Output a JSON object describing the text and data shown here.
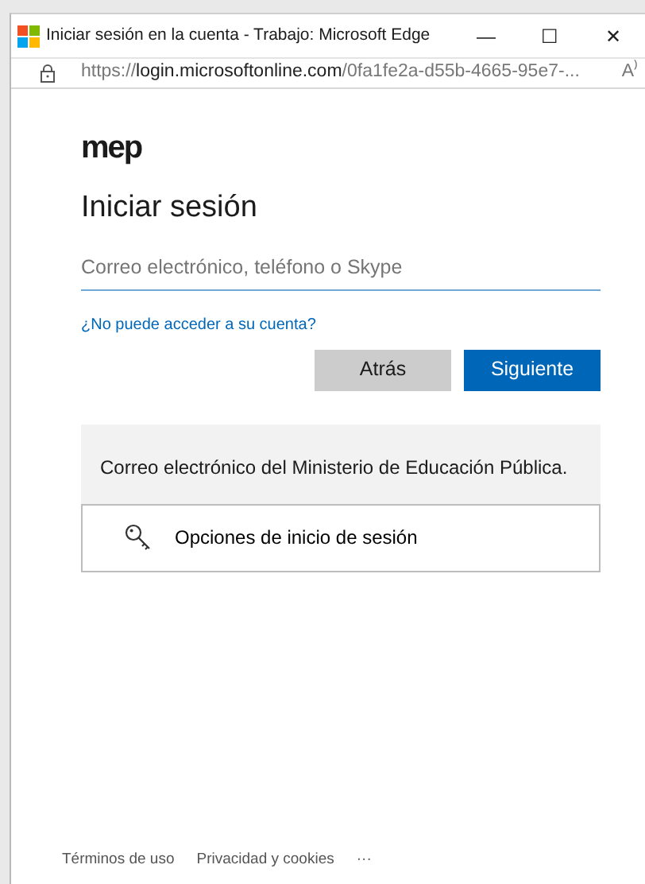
{
  "window": {
    "title": "Iniciar sesión en la cuenta - Trabajo: Microsoft Edge",
    "controls": [
      "—",
      "☐",
      "✕"
    ]
  },
  "address_bar": {
    "scheme": "https://",
    "host": "login.microsoftonline.com",
    "path": "/0fa1fe2a-d55b-4665-95e7-...",
    "reader": "A⁾"
  },
  "logo": {
    "text": "mep"
  },
  "heading": "Iniciar sesión",
  "email_field": {
    "placeholder": "Correo electrónico, teléfono o Skype"
  },
  "help_link": "¿No puede acceder a su cuenta?",
  "buttons": [
    {
      "label": "Atrás",
      "kind": "secondary"
    },
    {
      "label": "Siguiente",
      "kind": "primary"
    }
  ],
  "notice": "Correo electrónico del Ministerio de Educación Pública.",
  "signin_options": "Opciones de inicio de sesión",
  "footer": [
    "Términos de uso",
    "Privacidad y cookies",
    "···"
  ]
}
